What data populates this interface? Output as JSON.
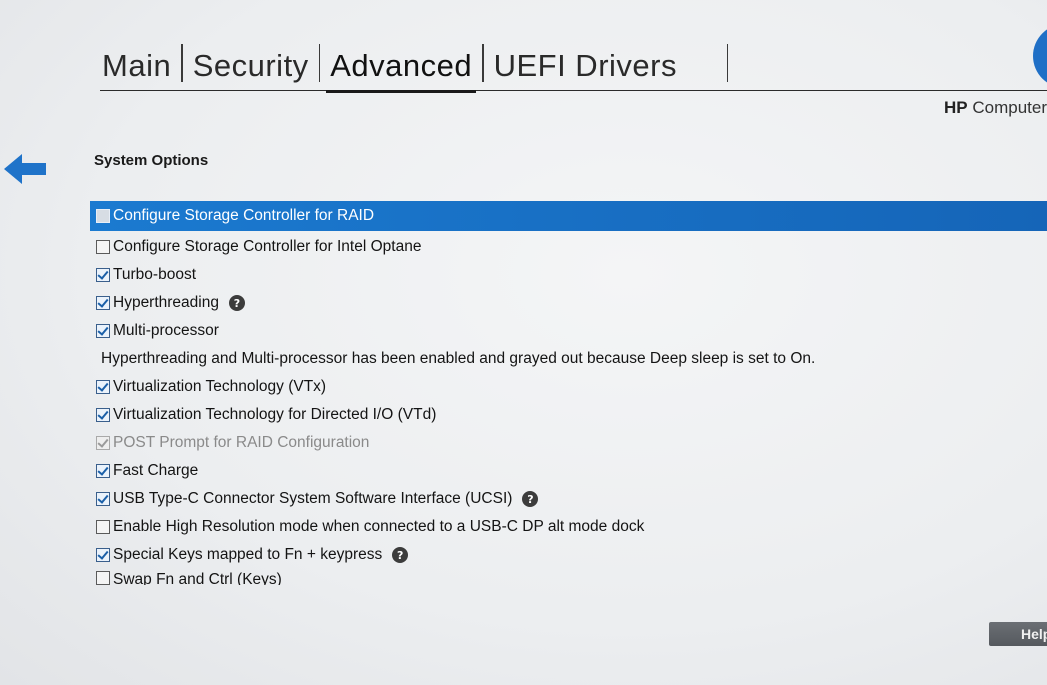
{
  "tabs": [
    {
      "label": "Main",
      "active": false
    },
    {
      "label": "Security",
      "active": false
    },
    {
      "label": "Advanced",
      "active": true
    },
    {
      "label": "UEFI Drivers",
      "active": false
    }
  ],
  "brand": {
    "mark": "HP",
    "text": "Computer"
  },
  "section_title": "System Options",
  "options": [
    {
      "label": "Configure Storage Controller for RAID",
      "checked": false,
      "selected": true
    },
    {
      "label": "Configure Storage Controller for Intel Optane",
      "checked": false
    },
    {
      "label": "Turbo-boost",
      "checked": true
    },
    {
      "label": "Hyperthreading",
      "checked": true,
      "help": true
    },
    {
      "label": "Multi-processor",
      "checked": true
    },
    {
      "note": "Hyperthreading and Multi-processor has been enabled and grayed out because Deep sleep is set to On."
    },
    {
      "label": "Virtualization Technology (VTx)",
      "checked": true
    },
    {
      "label": "Virtualization Technology for Directed I/O (VTd)",
      "checked": true
    },
    {
      "label": "POST Prompt for RAID Configuration",
      "checked": true,
      "disabled": true
    },
    {
      "label": "Fast Charge",
      "checked": true
    },
    {
      "label": "USB Type-C Connector System Software Interface (UCSI)",
      "checked": true,
      "help": true
    },
    {
      "label": "Enable High Resolution mode when connected to a USB-C DP alt mode dock",
      "checked": false
    },
    {
      "label": "Special Keys mapped to Fn + keypress",
      "checked": true,
      "help": true
    },
    {
      "label": "Swap Fn and Ctrl (Keys)",
      "checked": false,
      "clipped": true
    }
  ],
  "help_icon_glyph": "?",
  "help_button_label": "Help",
  "colors": {
    "selection": "#1b7ad0",
    "accent": "#1f6fc6",
    "arrow": "#1f73c9"
  }
}
